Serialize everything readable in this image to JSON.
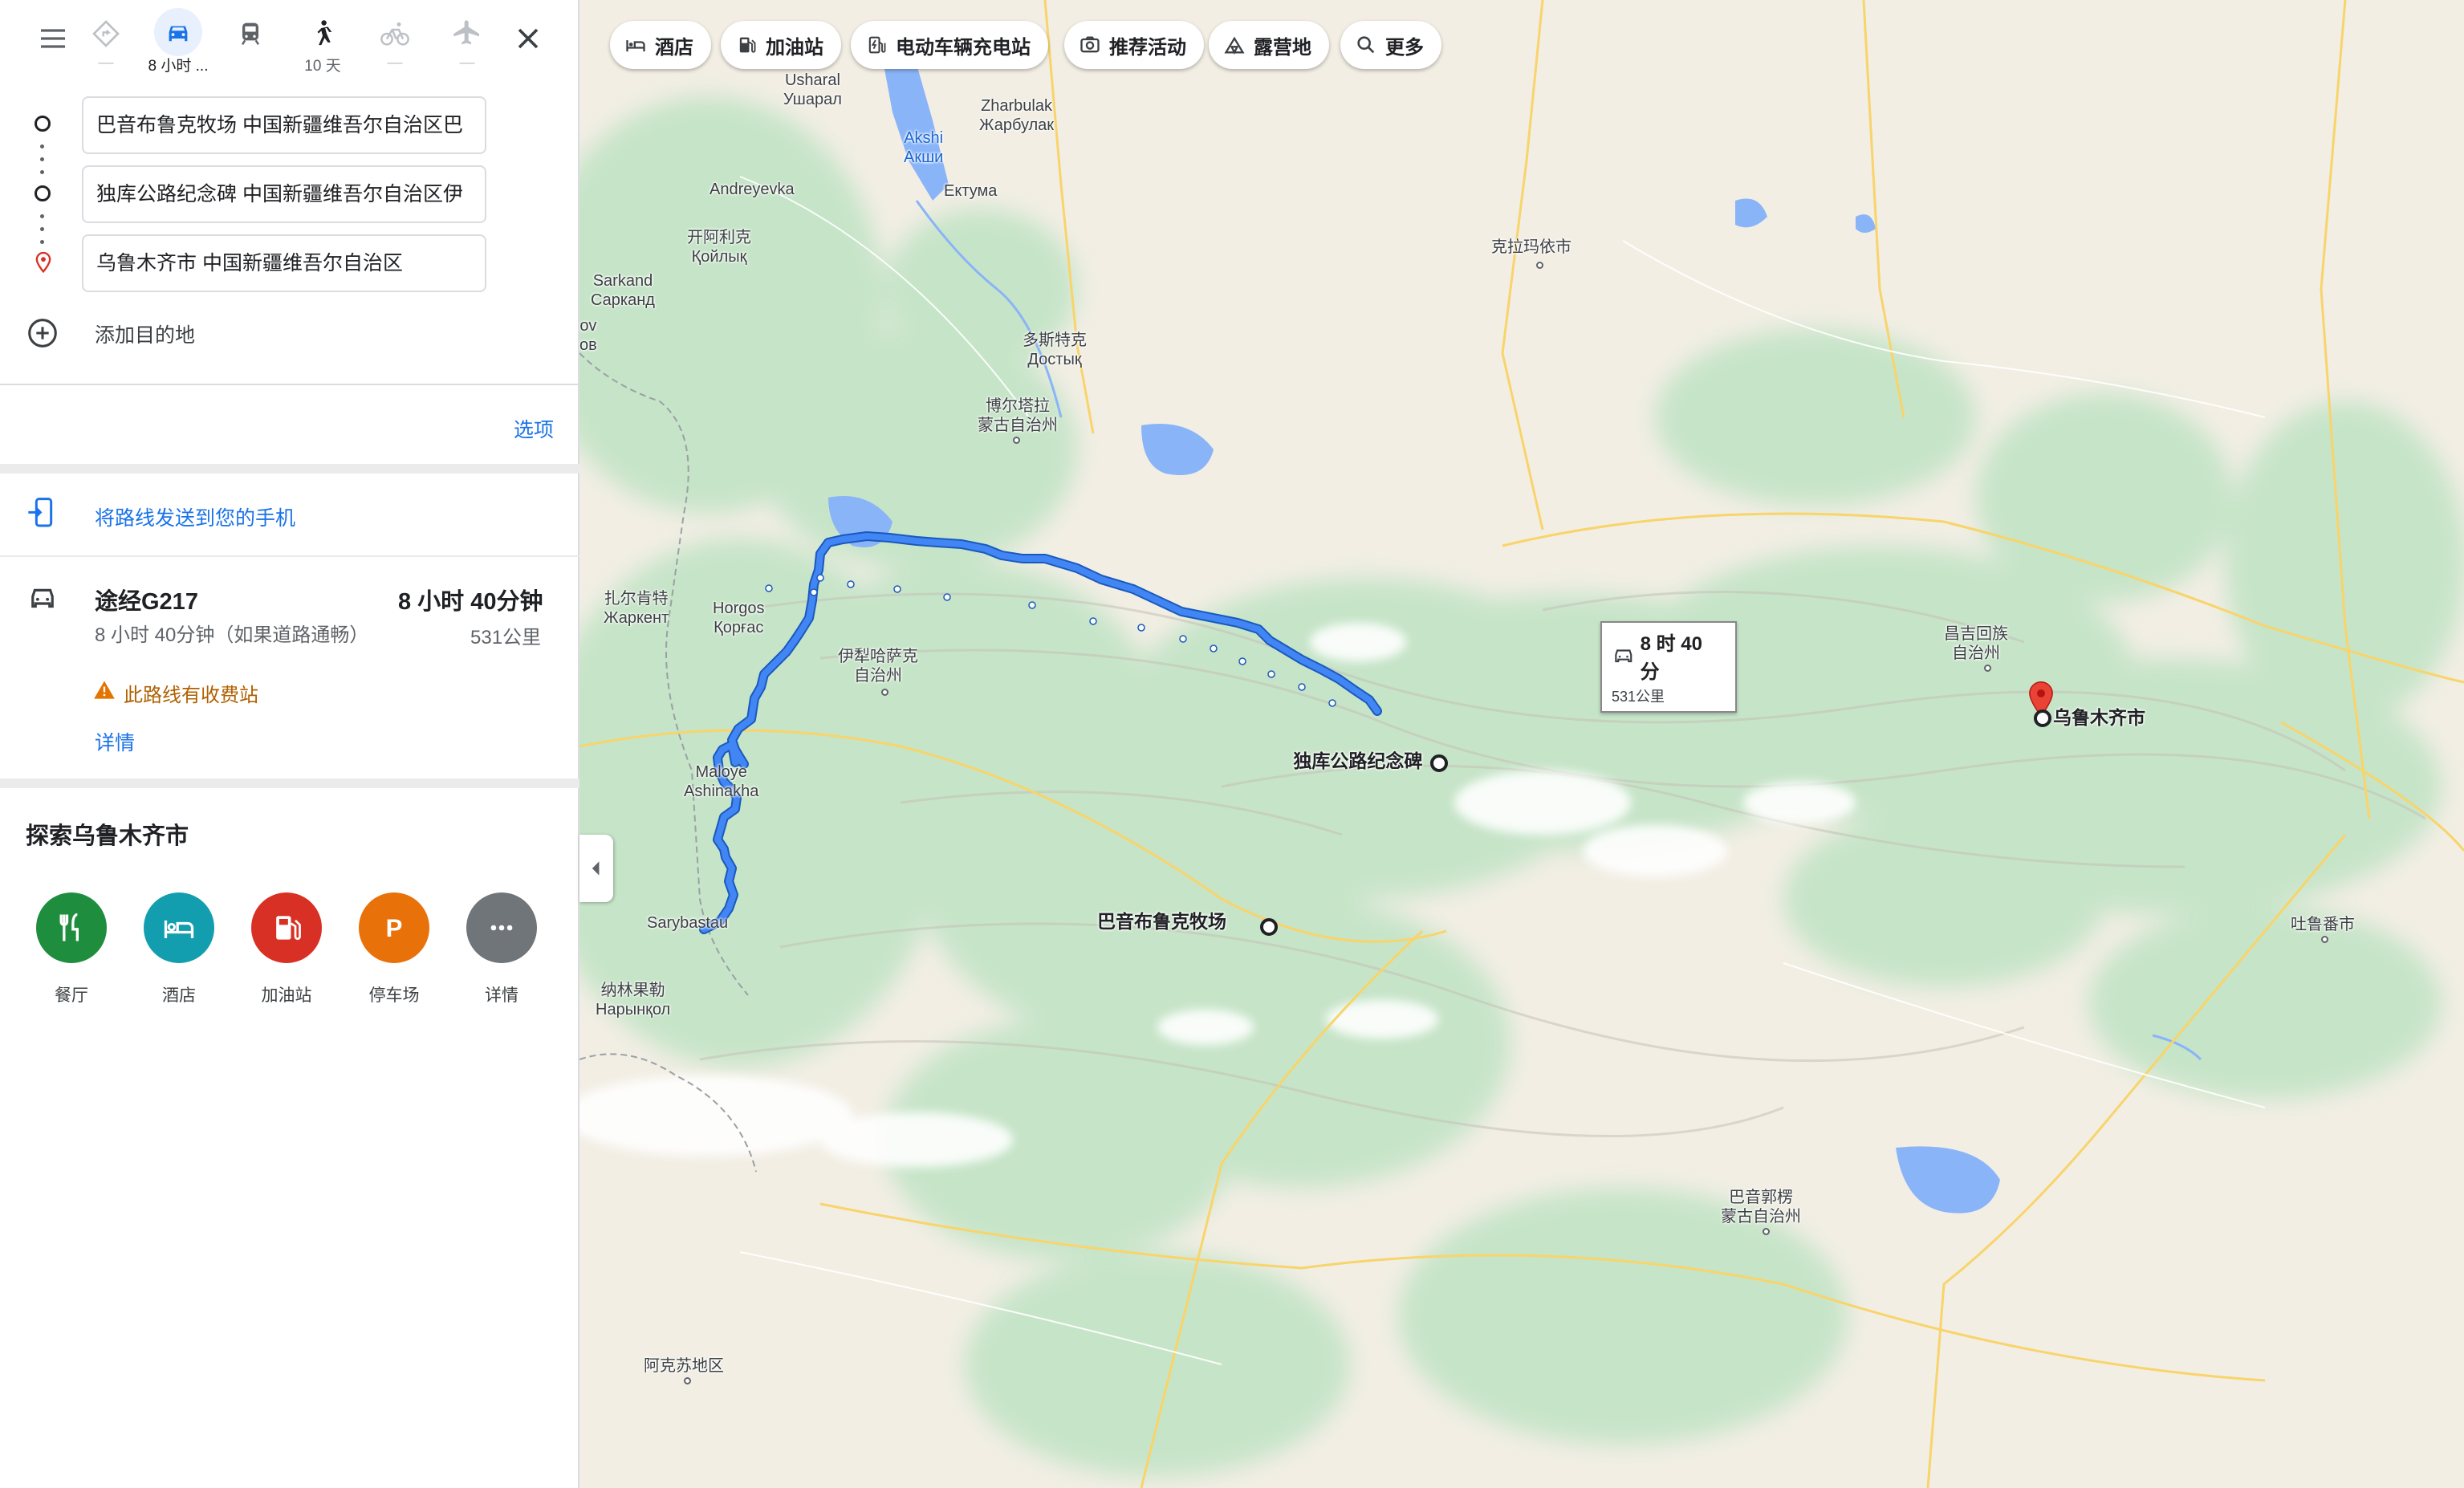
{
  "travel_modes": [
    {
      "name": "best-route",
      "label": "—"
    },
    {
      "name": "driving",
      "label": "8 小时 ..."
    },
    {
      "name": "transit",
      "label": ""
    },
    {
      "name": "walking",
      "label": "10 天"
    },
    {
      "name": "cycling",
      "label": "—"
    },
    {
      "name": "flights",
      "label": "—"
    }
  ],
  "waypoints": {
    "origin": "巴音布鲁克牧场 中国新疆维吾尔自治区巴",
    "stop": "独库公路纪念碑 中国新疆维吾尔自治区伊",
    "destination": "乌鲁木齐市 中国新疆维吾尔自治区",
    "add_destination": "添加目的地"
  },
  "options_label": "选项",
  "send_to_phone": "将路线发送到您的手机",
  "route": {
    "via": "途经G217",
    "duration": "8 小时 40分钟",
    "detail": "8 小时 40分钟（如果道路通畅）",
    "distance": "531公里",
    "warning": "此路线有收费站",
    "details_link": "详情"
  },
  "explore": {
    "title": "探索乌鲁木齐市",
    "categories": [
      {
        "label": "餐厅",
        "icon": "restaurant-icon",
        "color": "#1e8e3e"
      },
      {
        "label": "酒店",
        "icon": "hotel-icon",
        "color": "#129eaf"
      },
      {
        "label": "加油站",
        "icon": "gas-station-icon",
        "color": "#d93025"
      },
      {
        "label": "停车场",
        "icon": "parking-icon",
        "color": "#e8710a"
      },
      {
        "label": "详情",
        "icon": "more-icon",
        "color": "#70757a"
      }
    ]
  },
  "map_chips": [
    "酒店",
    "加油站",
    "电动车辆充电站",
    "推荐活动",
    "露营地",
    "更多"
  ],
  "route_callout": {
    "time": "8 时 40 分",
    "distance": "531公里"
  },
  "markers": {
    "origin": "巴音布鲁克牧场",
    "stop": "独库公路纪念碑",
    "destination": "乌鲁木齐市"
  },
  "place_labels": {
    "usharal_1": "Usharal",
    "usharal_2": "Ушарал",
    "aksi_1": "Akshi",
    "aksi_2": "Акши",
    "zharbulak_1": "Zharbulak",
    "zharbulak_2": "Жарбулак",
    "andreyevka": "Andreyevka",
    "ektuma": "Ектума",
    "kaiyike_1": "开阿利克",
    "kaiyike_2": "Қойлық",
    "sarkand_1": "Sarkand",
    "sarkand_2": "Сарканд",
    "ov_1": "ov",
    "ov_2": "ов",
    "karamay": "克拉玛依市",
    "dostyk_1": "多斯特克",
    "dostyk_2": "Достық",
    "bortala_1": "博尔塔拉",
    "bortala_2": "蒙古自治州",
    "zharkent_1": "扎尔肯特",
    "zharkent_2": "Жаркент",
    "horgos_1": "Horgos",
    "horgos_2": "Қорғас",
    "ili_1": "伊犁哈萨克",
    "ili_2": "自治州",
    "maloye_1": "Maloye",
    "maloye_2": "Ashinakha",
    "changji_1": "昌吉回族",
    "changji_2": "自治州",
    "sarybastau": "Sarybastau",
    "naryn_1": "纳林果勒",
    "naryn_2": "Нарынқол",
    "turpan": "吐鲁番市",
    "bayingol_1": "巴音郭楞",
    "bayingol_2": "蒙古自治州",
    "aksu": "阿克苏地区"
  }
}
